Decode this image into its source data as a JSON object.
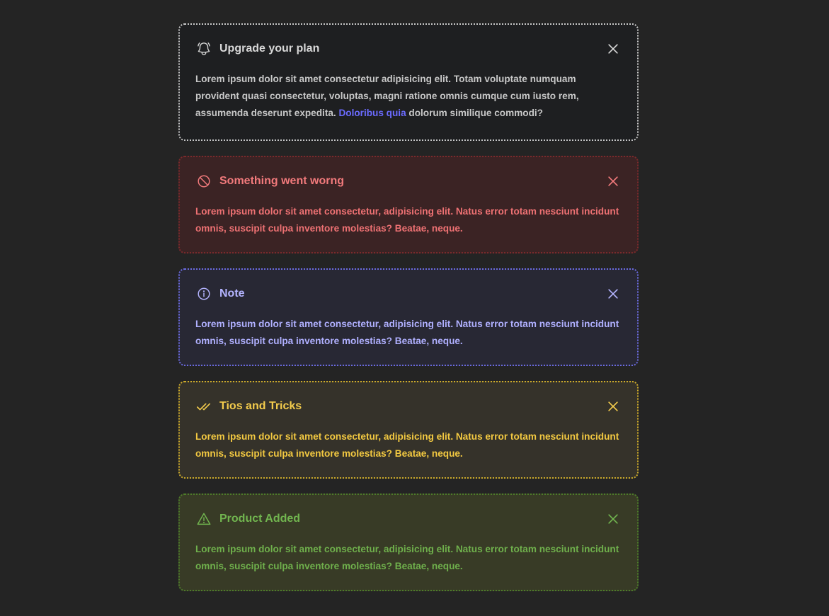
{
  "alerts": [
    {
      "variant": "default",
      "icon": "bell-icon",
      "title": "Upgrade your plan",
      "body_before": "Lorem ipsum dolor sit amet consectetur adipisicing elit. Totam voluptate numquam provident quasi consectetur, voluptas, magni ratione omnis cumque cum iusto rem, assumenda deserunt expedita. ",
      "link": "Doloribus quia",
      "body_after": " dolorum similique commodi?"
    },
    {
      "variant": "danger",
      "icon": "ban-icon",
      "title": "Something went worng",
      "body": "Lorem ipsum dolor sit amet consectetur, adipisicing elit. Natus error totam nesciunt incidunt omnis, suscipit culpa inventore molestias? Beatae, neque."
    },
    {
      "variant": "note",
      "icon": "info-icon",
      "title": "Note",
      "body": "Lorem ipsum dolor sit amet consectetur, adipisicing elit. Natus error totam nesciunt incidunt omnis, suscipit culpa inventore molestias? Beatae, neque."
    },
    {
      "variant": "tips",
      "icon": "double-check-icon",
      "title": "Tios and Tricks",
      "body": "Lorem ipsum dolor sit amet consectetur, adipisicing elit. Natus error totam nesciunt incidunt omnis, suscipit culpa inventore molestias? Beatae, neque."
    },
    {
      "variant": "success",
      "icon": "warning-triangle-icon",
      "title": "Product Added",
      "body": "Lorem ipsum dolor sit amet consectetur, adipisicing elit. Natus error totam nesciunt incidunt omnis, suscipit culpa inventore molestias? Beatae, neque."
    }
  ],
  "colors": {
    "page_background": "#242424",
    "link": "#6b6bff",
    "danger": "#f27a7c",
    "note": "#b4b4ff",
    "tips": "#f4cc4c",
    "success": "#71b54f"
  },
  "close_icon": "close-icon"
}
